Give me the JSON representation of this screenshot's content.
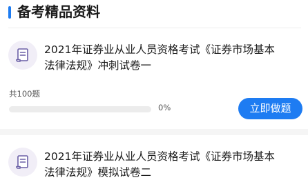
{
  "section": {
    "title": "备考精品资料"
  },
  "papers": [
    {
      "title_line1": "2021年证券业从业人员资格考试《证券市场基本",
      "title_line2": "法律法规》冲刺试卷一",
      "question_count": "共100题",
      "progress_text": "0%",
      "progress_fraction": 0,
      "action_label": "立即做题"
    },
    {
      "title_line1": "2021年证券业从业人员资格考试《证券市场基本",
      "title_line2": "法律法规》模拟试卷二"
    }
  ],
  "icons": {
    "paper": "document-scroll-icon"
  },
  "colors": {
    "accent": "#1E7CF2",
    "icon_bg": "#F1EEF7",
    "icon_stroke": "#6A5FA6",
    "track": "#ECECEC"
  }
}
